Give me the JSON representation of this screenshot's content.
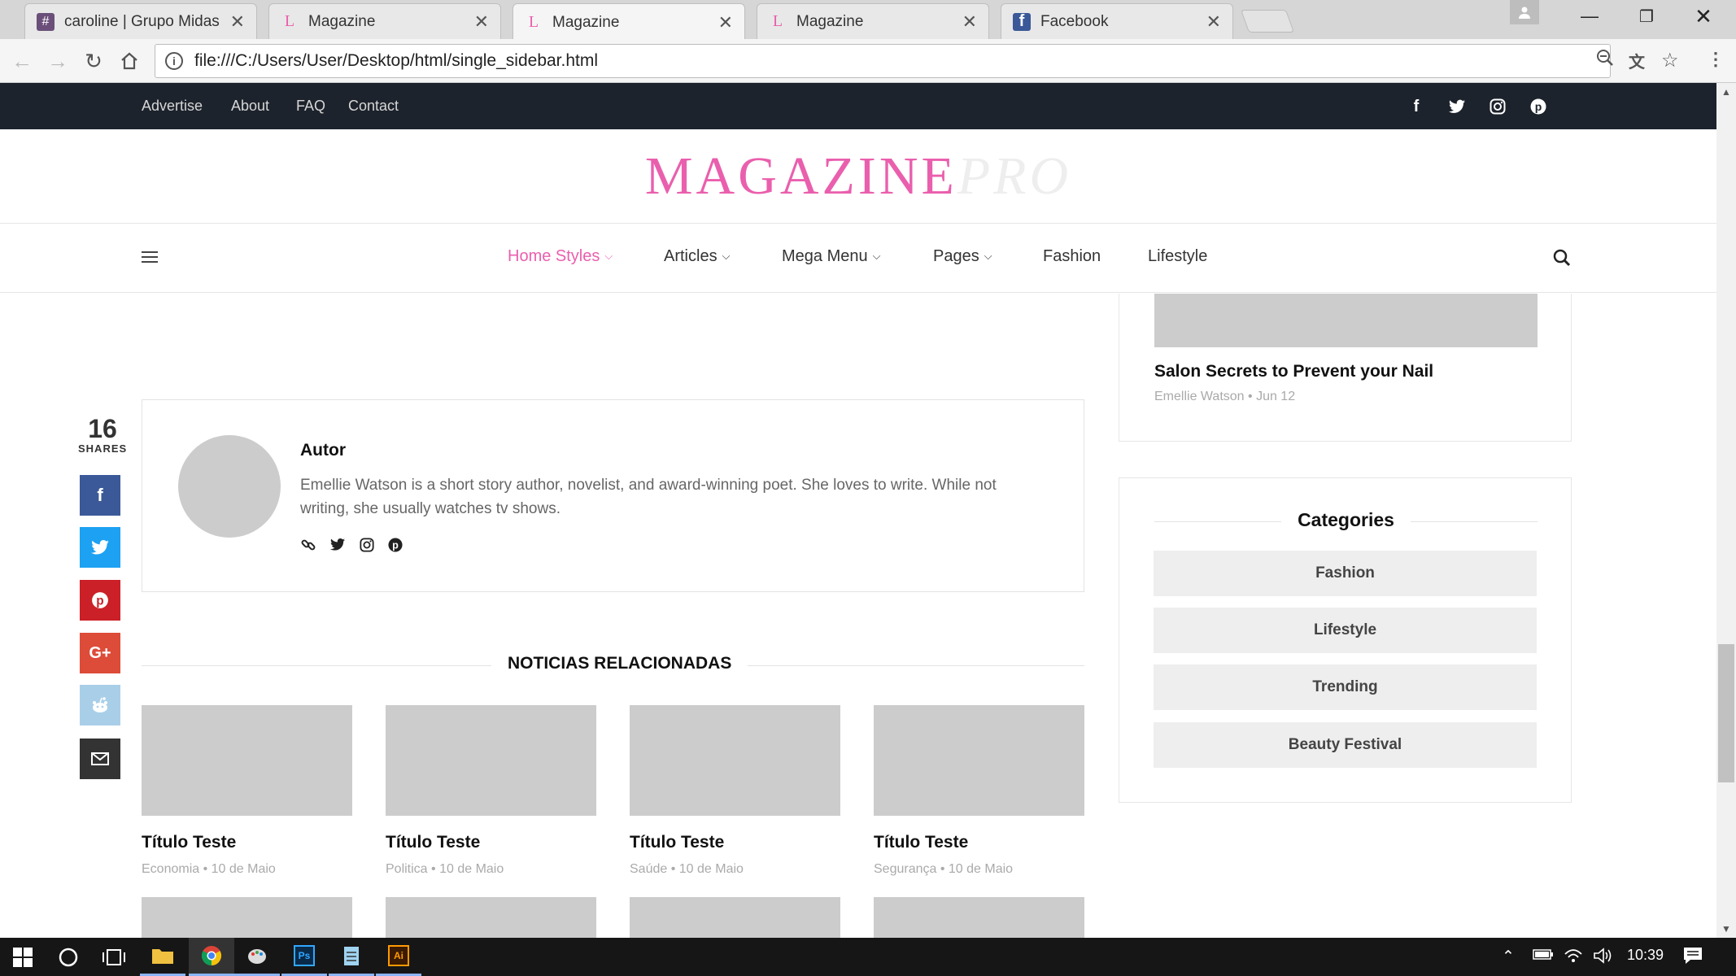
{
  "browser": {
    "tabs": [
      {
        "title": "caroline | Grupo Midas Sl",
        "icon": "slack-hash-icon",
        "icon_glyph": "#",
        "active": false
      },
      {
        "title": "Magazine",
        "icon": "magazine-l-icon",
        "icon_glyph": "L",
        "active": false
      },
      {
        "title": "Magazine",
        "icon": "magazine-l-icon",
        "icon_glyph": "L",
        "active": true
      },
      {
        "title": "Magazine",
        "icon": "magazine-l-icon",
        "icon_glyph": "L",
        "active": false
      },
      {
        "title": "Facebook",
        "icon": "facebook-icon",
        "icon_glyph": "f",
        "active": false
      }
    ],
    "url": "file:///C:/Users/User/Desktop/html/single_sidebar.html"
  },
  "site": {
    "topbar_links": [
      "Advertise",
      "About",
      "FAQ",
      "Contact"
    ],
    "logo_main": "MAGAZINE",
    "logo_accent": "PRO",
    "accent_color": "#ea5fad",
    "nav": [
      {
        "label": "Home Styles",
        "dropdown": true,
        "active": true
      },
      {
        "label": "Articles",
        "dropdown": true,
        "active": false
      },
      {
        "label": "Mega Menu",
        "dropdown": true,
        "active": false
      },
      {
        "label": "Pages",
        "dropdown": true,
        "active": false
      },
      {
        "label": "Fashion",
        "dropdown": false,
        "active": false
      },
      {
        "label": "Lifestyle",
        "dropdown": false,
        "active": false
      }
    ]
  },
  "share": {
    "count": "16",
    "label": "SHARES",
    "buttons": [
      {
        "name": "facebook",
        "glyph": "f",
        "color": "#3b5998"
      },
      {
        "name": "twitter",
        "glyph": "t",
        "color": "#1da1f2"
      },
      {
        "name": "pinterest",
        "glyph": "P",
        "color": "#cb2027"
      },
      {
        "name": "google-plus",
        "glyph": "G+",
        "color": "#dd4b39"
      },
      {
        "name": "reddit",
        "glyph": "r",
        "color": "#a9cfe8"
      },
      {
        "name": "email",
        "glyph": "✉",
        "color": "#333333"
      }
    ]
  },
  "author": {
    "heading": "Autor",
    "bio": "Emellie Watson is a short story author, novelist, and award-winning poet. She loves to write. While not writing, she usually watches tv shows."
  },
  "related": {
    "heading": "NOTICIAS RELACIONADAS",
    "items": [
      {
        "title": "Título Teste",
        "category": "Economia",
        "date": "10 de Maio"
      },
      {
        "title": "Título Teste",
        "category": "Politica",
        "date": "10 de Maio"
      },
      {
        "title": "Título Teste",
        "category": "Saúde",
        "date": "10 de Maio"
      },
      {
        "title": "Título Teste",
        "category": "Segurança",
        "date": "10 de Maio"
      }
    ]
  },
  "sidebar": {
    "post": {
      "title": "Salon Secrets to Prevent your Nail",
      "author": "Emellie Watson",
      "date": "Jun 12"
    },
    "categories_heading": "Categories",
    "categories": [
      "Fashion",
      "Lifestyle",
      "Trending",
      "Beauty Festival"
    ]
  },
  "taskbar": {
    "time": "10:39"
  }
}
